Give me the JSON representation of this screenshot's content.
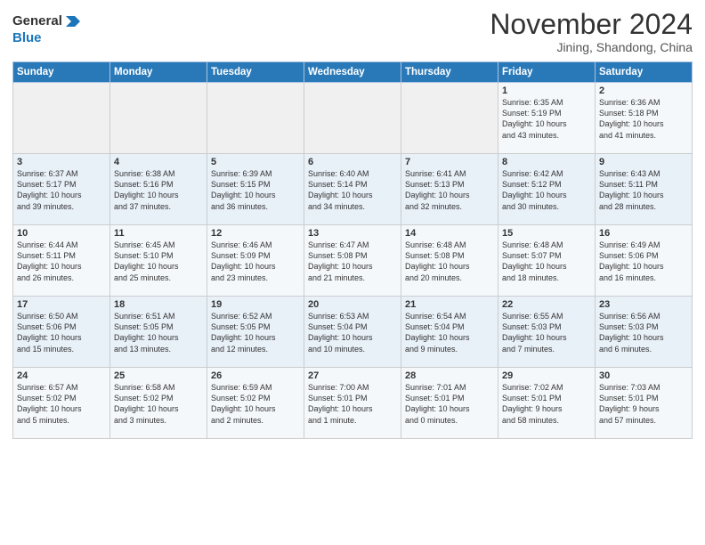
{
  "header": {
    "logo_general": "General",
    "logo_blue": "Blue",
    "month_title": "November 2024",
    "location": "Jining, Shandong, China"
  },
  "weekdays": [
    "Sunday",
    "Monday",
    "Tuesday",
    "Wednesday",
    "Thursday",
    "Friday",
    "Saturday"
  ],
  "weeks": [
    [
      {
        "day": "",
        "info": ""
      },
      {
        "day": "",
        "info": ""
      },
      {
        "day": "",
        "info": ""
      },
      {
        "day": "",
        "info": ""
      },
      {
        "day": "",
        "info": ""
      },
      {
        "day": "1",
        "info": "Sunrise: 6:35 AM\nSunset: 5:19 PM\nDaylight: 10 hours\nand 43 minutes."
      },
      {
        "day": "2",
        "info": "Sunrise: 6:36 AM\nSunset: 5:18 PM\nDaylight: 10 hours\nand 41 minutes."
      }
    ],
    [
      {
        "day": "3",
        "info": "Sunrise: 6:37 AM\nSunset: 5:17 PM\nDaylight: 10 hours\nand 39 minutes."
      },
      {
        "day": "4",
        "info": "Sunrise: 6:38 AM\nSunset: 5:16 PM\nDaylight: 10 hours\nand 37 minutes."
      },
      {
        "day": "5",
        "info": "Sunrise: 6:39 AM\nSunset: 5:15 PM\nDaylight: 10 hours\nand 36 minutes."
      },
      {
        "day": "6",
        "info": "Sunrise: 6:40 AM\nSunset: 5:14 PM\nDaylight: 10 hours\nand 34 minutes."
      },
      {
        "day": "7",
        "info": "Sunrise: 6:41 AM\nSunset: 5:13 PM\nDaylight: 10 hours\nand 32 minutes."
      },
      {
        "day": "8",
        "info": "Sunrise: 6:42 AM\nSunset: 5:12 PM\nDaylight: 10 hours\nand 30 minutes."
      },
      {
        "day": "9",
        "info": "Sunrise: 6:43 AM\nSunset: 5:11 PM\nDaylight: 10 hours\nand 28 minutes."
      }
    ],
    [
      {
        "day": "10",
        "info": "Sunrise: 6:44 AM\nSunset: 5:11 PM\nDaylight: 10 hours\nand 26 minutes."
      },
      {
        "day": "11",
        "info": "Sunrise: 6:45 AM\nSunset: 5:10 PM\nDaylight: 10 hours\nand 25 minutes."
      },
      {
        "day": "12",
        "info": "Sunrise: 6:46 AM\nSunset: 5:09 PM\nDaylight: 10 hours\nand 23 minutes."
      },
      {
        "day": "13",
        "info": "Sunrise: 6:47 AM\nSunset: 5:08 PM\nDaylight: 10 hours\nand 21 minutes."
      },
      {
        "day": "14",
        "info": "Sunrise: 6:48 AM\nSunset: 5:08 PM\nDaylight: 10 hours\nand 20 minutes."
      },
      {
        "day": "15",
        "info": "Sunrise: 6:48 AM\nSunset: 5:07 PM\nDaylight: 10 hours\nand 18 minutes."
      },
      {
        "day": "16",
        "info": "Sunrise: 6:49 AM\nSunset: 5:06 PM\nDaylight: 10 hours\nand 16 minutes."
      }
    ],
    [
      {
        "day": "17",
        "info": "Sunrise: 6:50 AM\nSunset: 5:06 PM\nDaylight: 10 hours\nand 15 minutes."
      },
      {
        "day": "18",
        "info": "Sunrise: 6:51 AM\nSunset: 5:05 PM\nDaylight: 10 hours\nand 13 minutes."
      },
      {
        "day": "19",
        "info": "Sunrise: 6:52 AM\nSunset: 5:05 PM\nDaylight: 10 hours\nand 12 minutes."
      },
      {
        "day": "20",
        "info": "Sunrise: 6:53 AM\nSunset: 5:04 PM\nDaylight: 10 hours\nand 10 minutes."
      },
      {
        "day": "21",
        "info": "Sunrise: 6:54 AM\nSunset: 5:04 PM\nDaylight: 10 hours\nand 9 minutes."
      },
      {
        "day": "22",
        "info": "Sunrise: 6:55 AM\nSunset: 5:03 PM\nDaylight: 10 hours\nand 7 minutes."
      },
      {
        "day": "23",
        "info": "Sunrise: 6:56 AM\nSunset: 5:03 PM\nDaylight: 10 hours\nand 6 minutes."
      }
    ],
    [
      {
        "day": "24",
        "info": "Sunrise: 6:57 AM\nSunset: 5:02 PM\nDaylight: 10 hours\nand 5 minutes."
      },
      {
        "day": "25",
        "info": "Sunrise: 6:58 AM\nSunset: 5:02 PM\nDaylight: 10 hours\nand 3 minutes."
      },
      {
        "day": "26",
        "info": "Sunrise: 6:59 AM\nSunset: 5:02 PM\nDaylight: 10 hours\nand 2 minutes."
      },
      {
        "day": "27",
        "info": "Sunrise: 7:00 AM\nSunset: 5:01 PM\nDaylight: 10 hours\nand 1 minute."
      },
      {
        "day": "28",
        "info": "Sunrise: 7:01 AM\nSunset: 5:01 PM\nDaylight: 10 hours\nand 0 minutes."
      },
      {
        "day": "29",
        "info": "Sunrise: 7:02 AM\nSunset: 5:01 PM\nDaylight: 9 hours\nand 58 minutes."
      },
      {
        "day": "30",
        "info": "Sunrise: 7:03 AM\nSunset: 5:01 PM\nDaylight: 9 hours\nand 57 minutes."
      }
    ]
  ]
}
